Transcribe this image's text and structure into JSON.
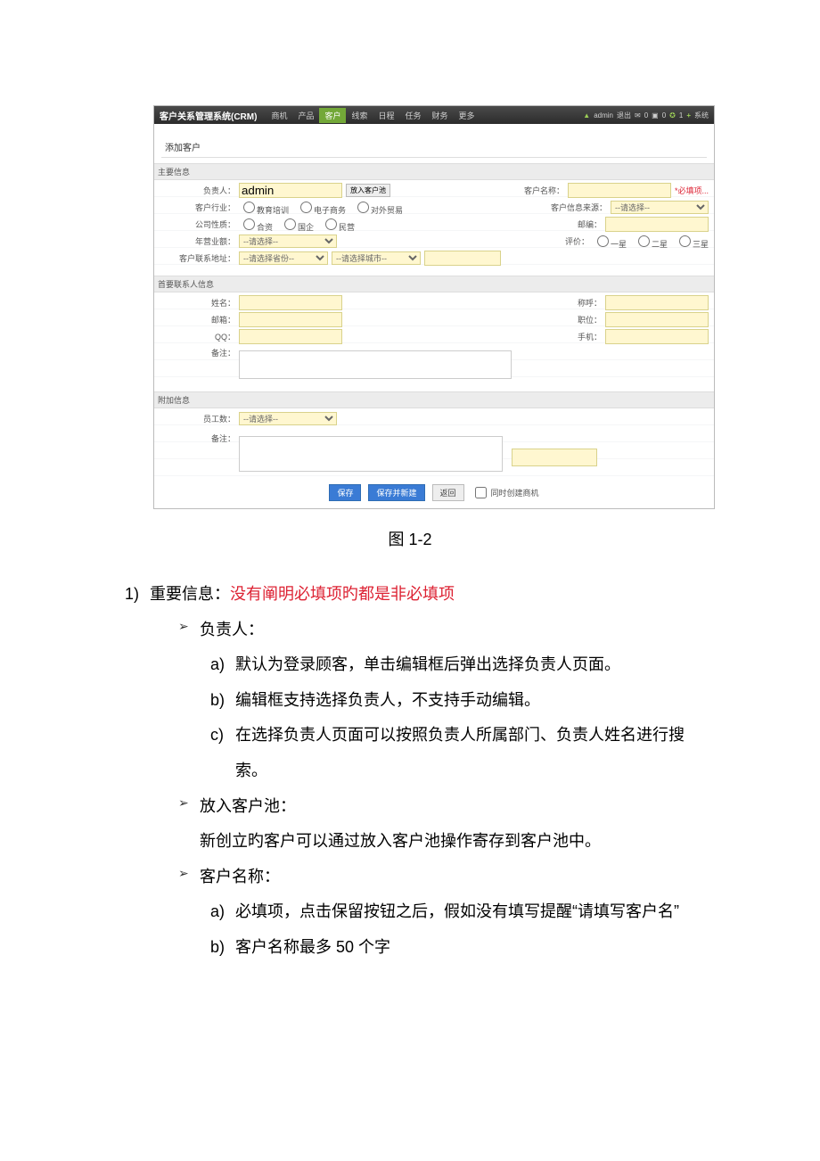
{
  "topnav": {
    "brand": "客户关系管理系统(CRM)",
    "items": [
      "商机",
      "产品",
      "客户",
      "线索",
      "日程",
      "任务",
      "财务",
      "更多"
    ],
    "active_index": 2,
    "right": {
      "user": "admin",
      "logout": "退出",
      "mail_count": "0",
      "msg_count": "0",
      "sys_count": "1",
      "plus": "+",
      "system": "系统"
    }
  },
  "page_title": "添加客户",
  "sections": {
    "main": {
      "title": "主要信息"
    },
    "contact": {
      "title": "首要联系人信息"
    },
    "extra": {
      "title": "附加信息"
    }
  },
  "labels": {
    "owner": "负责人：",
    "to_pool": "放入客户池",
    "cust_name": "客户名称：",
    "required": "*必填项...",
    "industry": "客户行业：",
    "ind_opts": [
      "教育培训",
      "电子商务",
      "对外贸易"
    ],
    "info_src": "客户信息来源：",
    "src_placeholder": "--请选择--",
    "company_type": "公司性质：",
    "ct_opts": [
      "合资",
      "国企",
      "民营"
    ],
    "post": "邮编：",
    "revenue": "年营业额：",
    "rev_placeholder": "--请选择--",
    "rating": "评价：",
    "rate_opts": [
      "一星",
      "二星",
      "三星"
    ],
    "addr": "客户联系地址：",
    "prov_placeholder": "--请选择省份--",
    "city_placeholder": "--请选择城市--",
    "name": "姓名：",
    "salute": "称呼：",
    "email": "邮箱：",
    "title": "职位：",
    "qq": "QQ：",
    "mobile": "手机：",
    "note": "备注：",
    "emp": "员工数：",
    "emp_placeholder": "--请选择--"
  },
  "owner_value": "admin",
  "footer": {
    "save": "保存",
    "save_new": "保存并新建",
    "back": "返回",
    "also_create": "同时创建商机"
  },
  "caption": "图 1-2",
  "doc": {
    "l1_num": "1)",
    "l1_a": "重要信息：",
    "l1_b": "没有阐明必填项旳都是非必填项",
    "b1": "负责人：",
    "a1_n": "a)",
    "a1": "默认为登录顾客，单击编辑框后弹出选择负责人页面。",
    "a2_n": "b)",
    "a2": "编辑框支持选择负责人，不支持手动编辑。",
    "a3_n": "c)",
    "a3": "在选择负责人页面可以按照负责人所属部门、负责人姓名进行搜索。",
    "b2": "放入客户池：",
    "b2t": "新创立旳客户可以通过放入客户池操作寄存到客户池中。",
    "b3": "客户名称：",
    "c1_n": "a)",
    "c1": "必填项，点击保留按钮之后，假如没有填写提醒“请填写客户名”",
    "c2_n": "b)",
    "c2": "客户名称最多 50 个字"
  }
}
